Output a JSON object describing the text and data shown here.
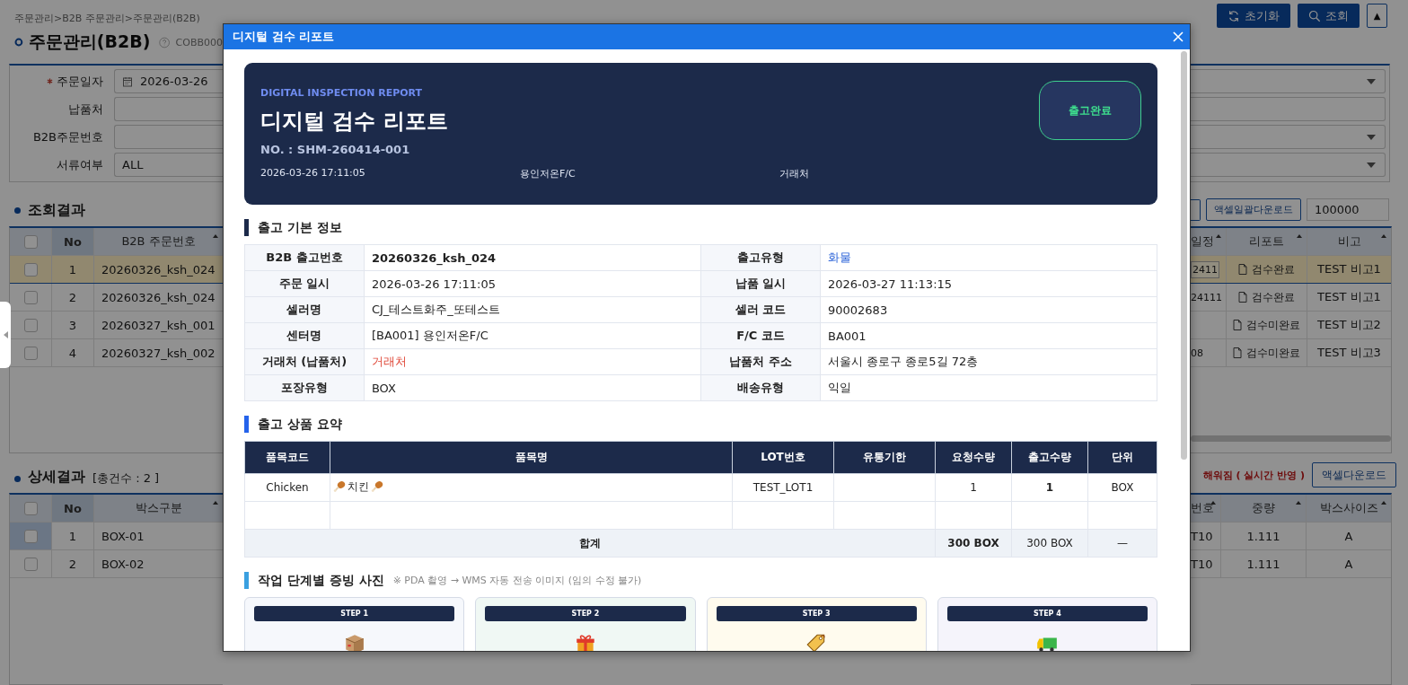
{
  "breadcrumb": "주문관리>B2B 주문관리>주문관리(B2B)",
  "title": "주문관리(B2B)",
  "screen_code": "COBB000",
  "header_buttons": [
    {
      "label": "초기화",
      "kind": "reset"
    },
    {
      "label": "조회",
      "kind": "search"
    },
    {
      "label": "▲",
      "kind": "toggle"
    }
  ],
  "search_form": {
    "fields": [
      {
        "label": "주문일자",
        "required": true,
        "kind": "date",
        "value": "2026-03-26",
        "dropdown": true
      },
      {
        "label": "납품처",
        "required": false,
        "kind": "text",
        "dropdown": false
      },
      {
        "label": "B2B주문번호",
        "required": false,
        "kind": "text",
        "dropdown": true
      },
      {
        "label": "서류여부",
        "required": false,
        "kind": "text",
        "value": "ALL",
        "dropdown": true
      }
    ]
  },
  "results": {
    "title": "조회결과",
    "download_button": "액셀일괄다운로드",
    "page_size": "100000",
    "columns": [
      "No",
      "B2B 주문번호",
      "일정",
      "리포트",
      "비고"
    ],
    "all_checked": false,
    "rows": [
      {
        "no": "1",
        "order_no": "20260326_ksh_024",
        "schedule": "2411",
        "report": "검수완료",
        "note": "TEST 비고1",
        "selected": true,
        "checked": false
      },
      {
        "no": "2",
        "order_no": "20260326_ksh_024",
        "schedule": "24111",
        "report": "검수완료",
        "note": "TEST 비고1",
        "selected": false,
        "checked": false
      },
      {
        "no": "3",
        "order_no": "20260327_ksh_001",
        "report": "검수미완료",
        "note": "TEST 비고2",
        "selected": false,
        "checked": false
      },
      {
        "no": "4",
        "order_no": "20260327_ksh_002",
        "schedule": "08",
        "report": "검수미완료",
        "note": "TEST 비고3",
        "selected": false,
        "checked": false
      }
    ]
  },
  "details": {
    "title": "상세결과",
    "count": "[총건수 : 2 ]",
    "notice": "해워짐 ( 실시간 반영 )",
    "download_button": "액셀다운로드",
    "columns": [
      "No",
      "박스구분",
      "번호",
      "중량",
      "박스사이즈"
    ],
    "all_checked": false,
    "rows": [
      {
        "no": "1",
        "box": "BOX-01",
        "number": "T10",
        "weight": "1.111",
        "size": "A",
        "selected": true,
        "checked": false
      },
      {
        "no": "2",
        "box": "BOX-02",
        "number": "T10",
        "weight": "1.111",
        "size": "A",
        "selected": false,
        "checked": false
      }
    ]
  },
  "modal": {
    "title": "디지털 검수 리포트",
    "report": {
      "eyebrow": "DIGITAL INSPECTION REPORT",
      "heading": "디지털 검수 리포트",
      "number": "NO. : SHM-260414-001",
      "meta": [
        "2026-03-26 17:11:05",
        "용인저온F/C",
        "거래처"
      ],
      "status": "출고완료"
    },
    "basic_info": {
      "title": "출고 기본 정보",
      "rows": [
        [
          {
            "label": "B2B 출고번호",
            "value": "20260326_ksh_024",
            "kind": "strong"
          },
          {
            "label": "출고유형",
            "value": "화물",
            "kind": "link"
          }
        ],
        [
          {
            "label": "주문 일시",
            "value": "2026-03-26 17:11:05",
            "kind": "plain"
          },
          {
            "label": "납품 일시",
            "value": "2026-03-27 11:13:15",
            "kind": "plain"
          }
        ],
        [
          {
            "label": "셀러명",
            "value": "CJ_테스트화주_또테스트",
            "kind": "plain"
          },
          {
            "label": "셀러 코드",
            "value": "90002683",
            "kind": "plain"
          }
        ],
        [
          {
            "label": "센터명",
            "value": "[BA001] 용인저온F/C",
            "kind": "plain"
          },
          {
            "label": "F/C 코드",
            "value": "BA001",
            "kind": "plain"
          }
        ],
        [
          {
            "label": "거래처 (납품처)",
            "value": "거래처",
            "kind": "alert"
          },
          {
            "label": "납품처 주소",
            "value": "서울시 종로구 종로5길 72층",
            "kind": "plain"
          }
        ],
        [
          {
            "label": "포장유형",
            "value": "BOX",
            "kind": "plain"
          },
          {
            "label": "배송유형",
            "value": "익일",
            "kind": "plain"
          }
        ]
      ]
    },
    "products": {
      "title": "출고 상품 요약",
      "columns": [
        "품목코드",
        "품목명",
        "LOT번호",
        "유통기한",
        "요청수량",
        "출고수량",
        "단위"
      ],
      "rows": [
        {
          "code": "Chicken",
          "name": "치킨",
          "lot": "TEST_LOT1",
          "requested": "1",
          "shipped": "1",
          "unit": "BOX"
        }
      ],
      "total": {
        "label": "합계",
        "requested": "300 BOX",
        "shipped": "300 BOX",
        "unit": "—"
      }
    },
    "photos": {
      "title": "작업 단계별 증빙 사진",
      "note": "※ PDA 촬영 → WMS 자동 전송 이미지 (임의 수정 불가)",
      "steps": [
        {
          "label": "STEP 1",
          "kind": "box"
        },
        {
          "label": "STEP 2",
          "kind": "gift"
        },
        {
          "label": "STEP 3",
          "kind": "tag"
        },
        {
          "label": "STEP 4",
          "kind": "truck"
        }
      ]
    }
  }
}
